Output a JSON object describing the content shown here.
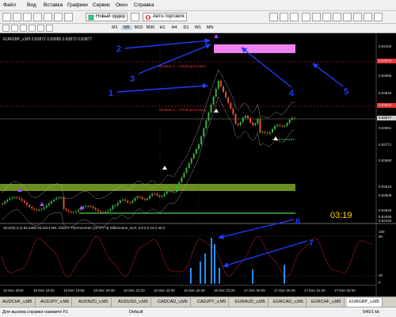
{
  "menu": [
    "Файл",
    "Вид",
    "Вставка",
    "Графики",
    "Сервис",
    "Окно",
    "Справка"
  ],
  "toolbar": {
    "new_order": "Новый ордер",
    "autotrading": "Авто-торговля"
  },
  "timeframes": [
    "M1",
    "M5",
    "M15",
    "M30",
    "H1",
    "H4",
    "D1",
    "W1",
    "MN"
  ],
  "chart": {
    "header": "EURGBP_v,M5  0.83872 0.83885 0.83872 0.83877",
    "level_labels": [
      "Уровень 2 - отбой цены вниз",
      "Уровень 1 - отбой цены вниз"
    ],
    "price_labels": [
      "0.84155",
      "0.84076",
      "0.83995",
      "0.83940",
      "0.83923",
      "0.83877",
      "0.83851",
      "0.83771",
      "0.83690",
      "0.83618",
      "0.83609",
      "0.83526",
      "0.83466",
      "0.83445"
    ],
    "timer": "03:19",
    "annotations": [
      "1",
      "2",
      "3",
      "4",
      "5",
      "6",
      "7"
    ]
  },
  "oscillator": {
    "header": "Stoch(5,3,3) 83.4356 83.0314  MS: Elder's Thermometer [22*3*7*3] Silbermann_inch, 6.8 6.0 15.2 46.0",
    "scale": [
      "100",
      "80",
      "20",
      "0"
    ]
  },
  "time_labels": [
    "16 Dec 2019",
    "16 Dec 19:20",
    "16 Dec 19:55",
    "16 Dec 20:40",
    "16 Dec 21:20",
    "16 Dec 22:00",
    "16 Dec 22:40",
    "16 Dec 23:25",
    "17 Dec 00:05",
    "17 Dec 00:45",
    "17 Dec 01:25",
    "17 Dec 02:05"
  ],
  "symbol_tabs": [
    "AUDCHF_v,M5",
    "AUDJPY_v,M5",
    "AUDNZD_v,M5",
    "AUDUSD_v,M5",
    "CADCAD_v,M5",
    "CADJPY_v,M5",
    "EURAUD_v,M5",
    "EURCAD_v,M5",
    "EURCHF_v,M5",
    "EURGBP_v,M5"
  ],
  "status": {
    "help": "Для вызова справки нажмите F1",
    "profile": "Default",
    "traffic": "545/1 kb"
  },
  "colors": {
    "bull": "#3cb043",
    "bear": "#e2542d",
    "zone_pink": "#ee82ee",
    "zone_olive": "#6b8e23",
    "arrow": "#1e3cff",
    "timer": "#ffd700"
  }
}
